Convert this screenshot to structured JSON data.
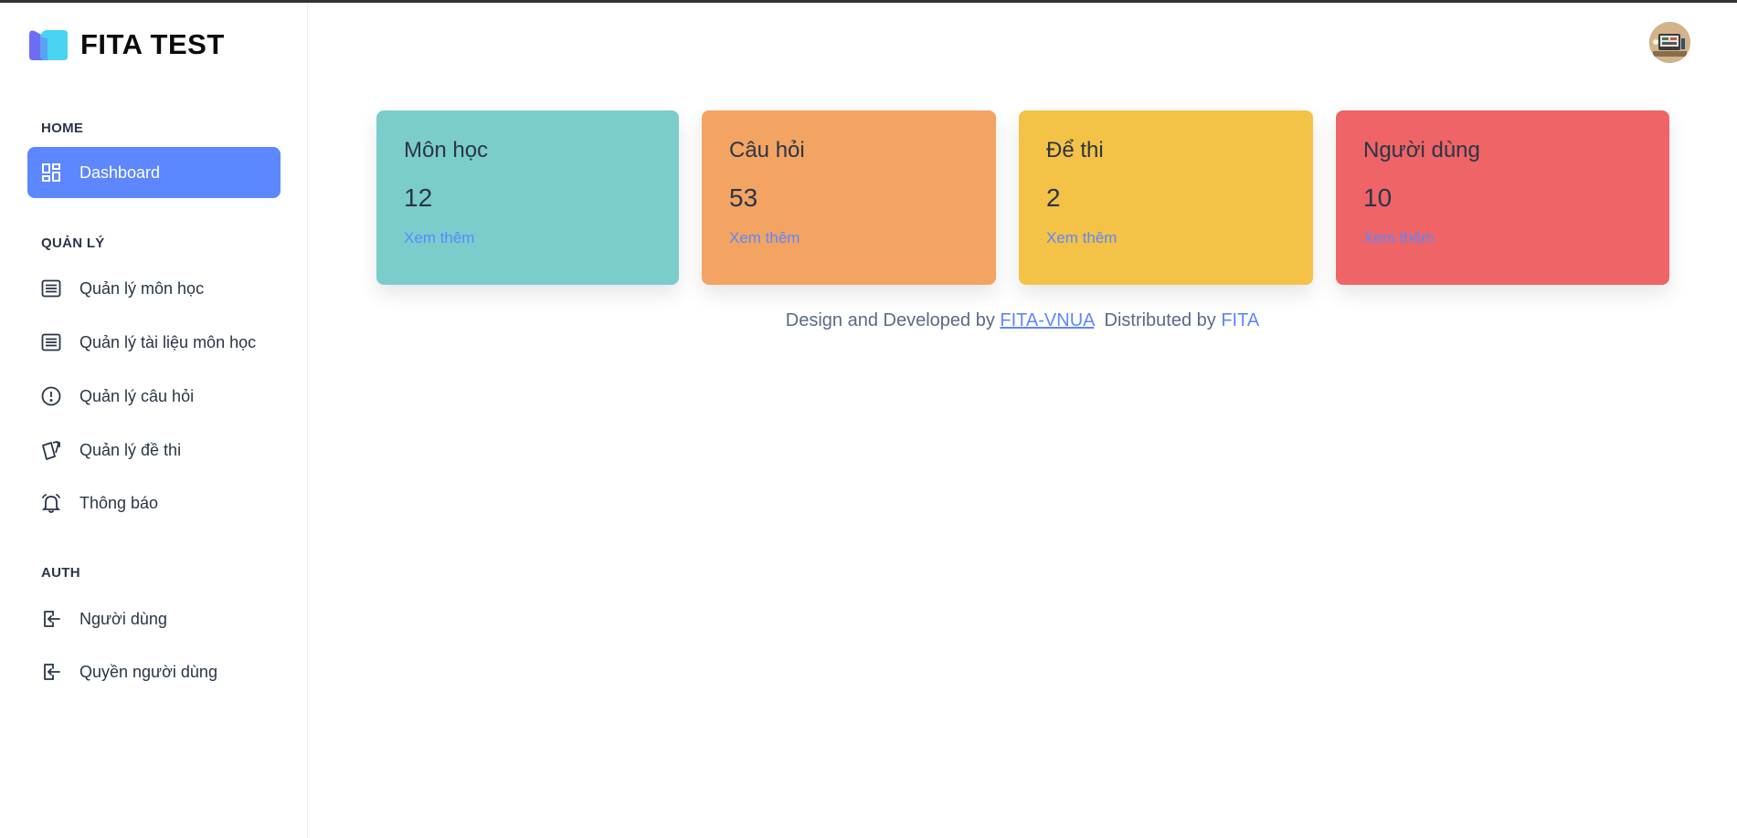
{
  "brand": {
    "name": "FITA TEST"
  },
  "sidebar": {
    "sections": [
      "HOME",
      "QUẢN LÝ",
      "AUTH"
    ],
    "items": [
      {
        "label": "Dashboard",
        "icon": "dashboard-icon"
      },
      {
        "label": "Quản lý môn học",
        "icon": "list-icon"
      },
      {
        "label": "Quản lý tài liệu môn học",
        "icon": "list-icon"
      },
      {
        "label": "Quản lý câu hỏi",
        "icon": "alert-circle-icon"
      },
      {
        "label": "Quản lý đề thi",
        "icon": "cards-icon"
      },
      {
        "label": "Thông báo",
        "icon": "bell-icon"
      },
      {
        "label": "Người dùng",
        "icon": "login-icon"
      },
      {
        "label": "Quyền người dùng",
        "icon": "login-icon"
      }
    ]
  },
  "cards": [
    {
      "title": "Môn học",
      "value": "12",
      "link": "Xem thêm",
      "color": "#7bcdcc"
    },
    {
      "title": "Câu hỏi",
      "value": "53",
      "link": "Xem thêm",
      "color": "#f3a462"
    },
    {
      "title": "Để thi",
      "value": "2",
      "link": "Xem thêm",
      "color": "#f3c246"
    },
    {
      "title": "Người dùng",
      "value": "10",
      "link": "Xem thêm",
      "color": "#ef6467"
    }
  ],
  "footer": {
    "prefix": "Design and Developed by",
    "link1": "FITA-VNUA",
    "middle": "Distributed by",
    "link2": "FITA"
  },
  "colors": {
    "accent": "#5d87ff",
    "text": "#2a3547"
  }
}
